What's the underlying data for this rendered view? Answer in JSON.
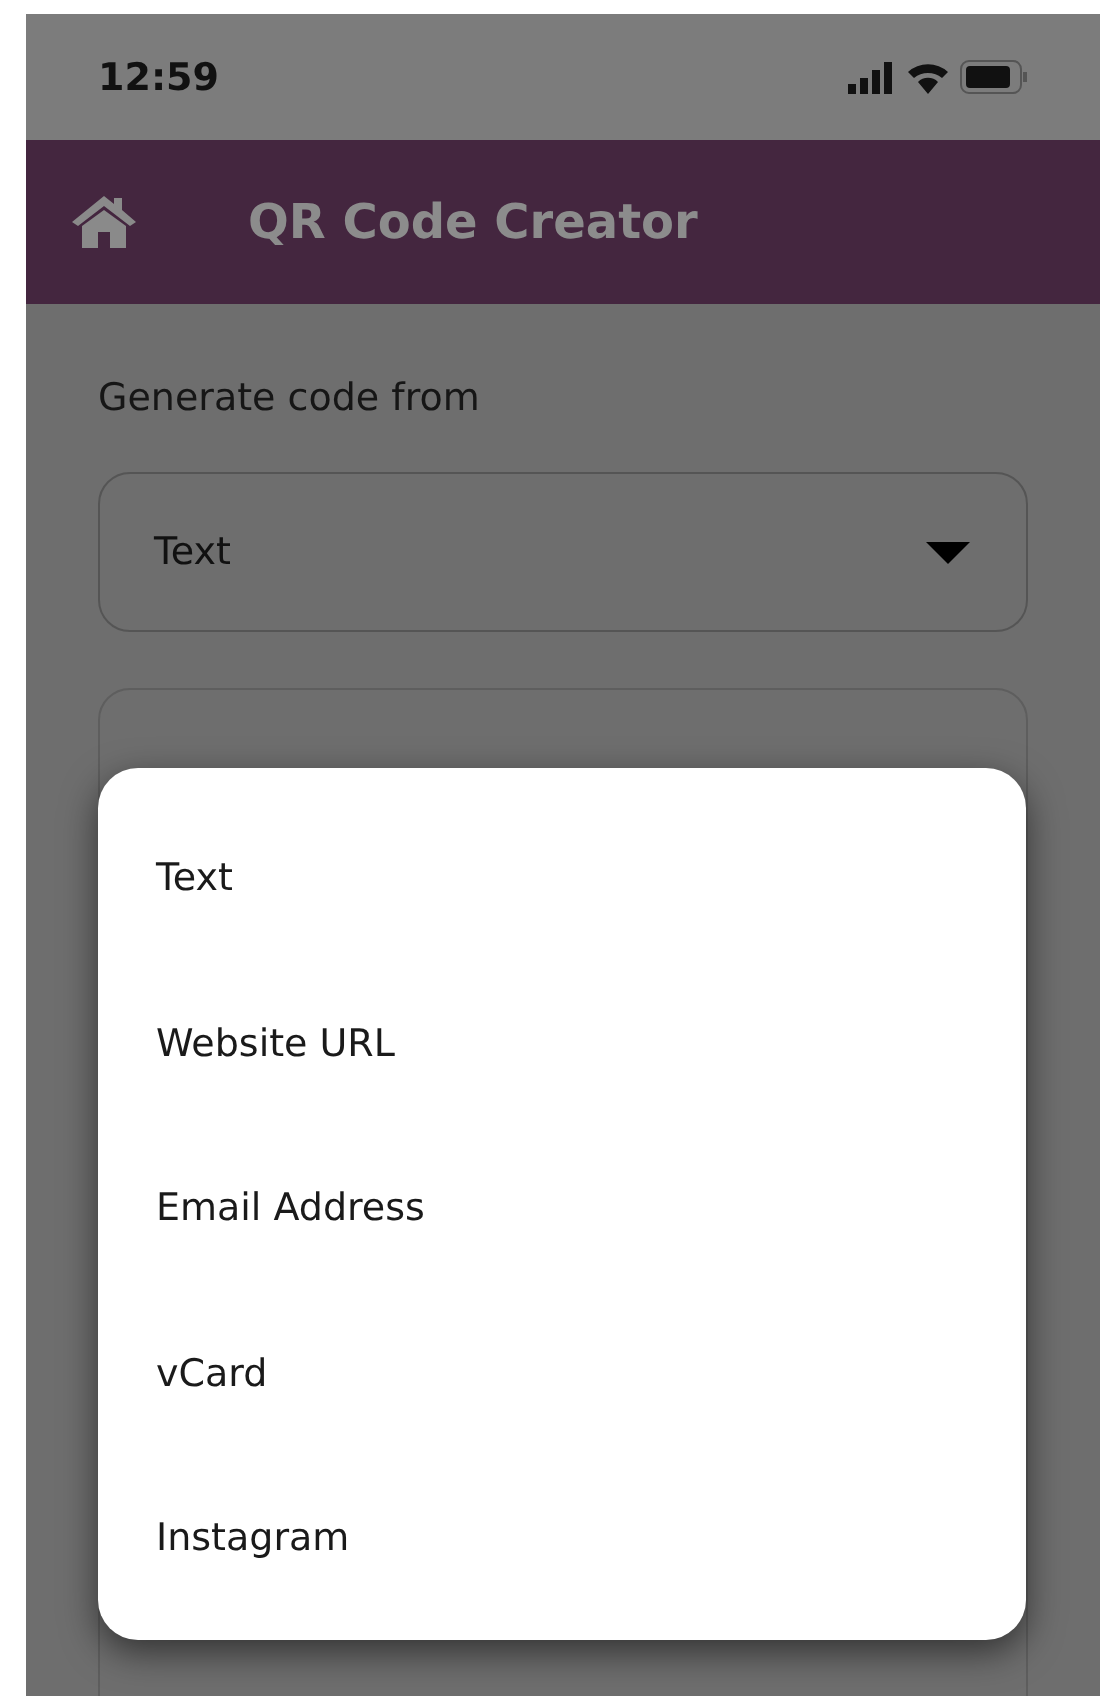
{
  "status_bar": {
    "time": "12:59"
  },
  "header": {
    "title": "QR Code Creator"
  },
  "form": {
    "label": "Generate code from",
    "dropdown": {
      "value": "Text"
    }
  },
  "menu": {
    "items": [
      {
        "label": "Text"
      },
      {
        "label": "Website URL"
      },
      {
        "label": "Email Address"
      },
      {
        "label": "vCard"
      },
      {
        "label": "Instagram"
      }
    ]
  }
}
